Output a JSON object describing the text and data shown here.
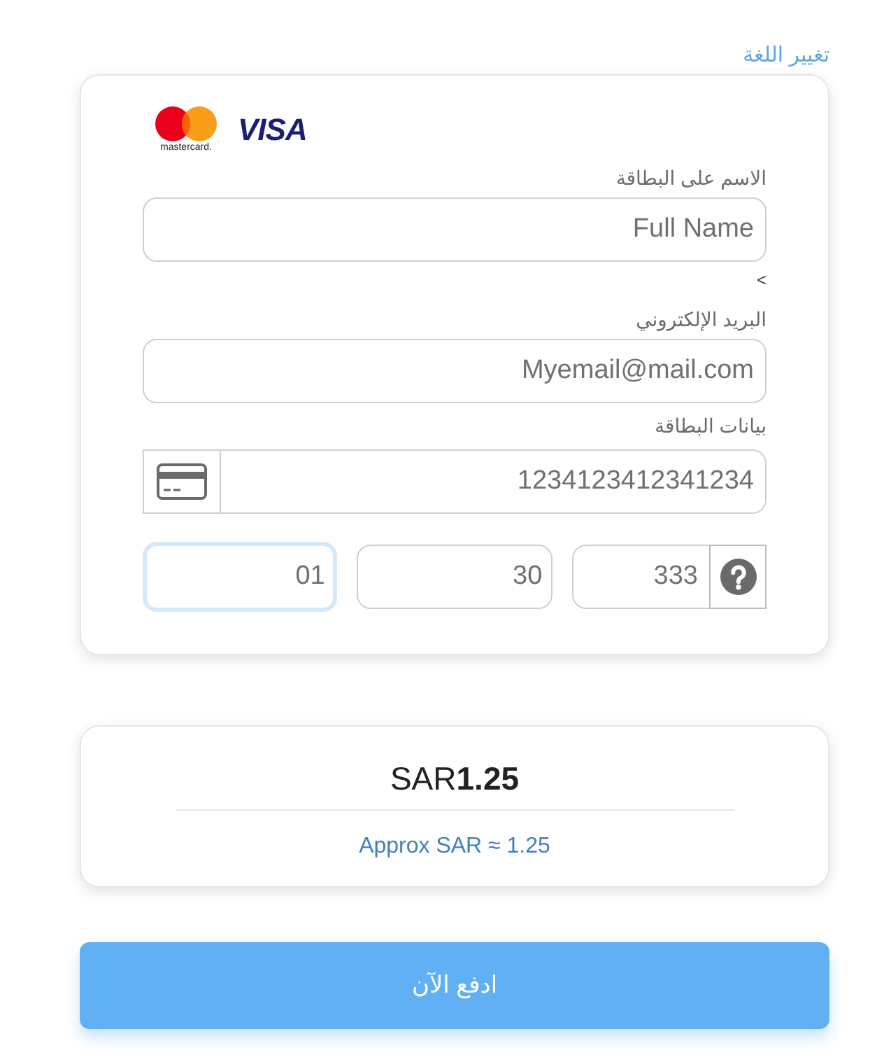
{
  "language_link": {
    "label": "تغيير اللغة"
  },
  "card_brands": [
    {
      "kind": "mastercard",
      "label": "mastercard."
    },
    {
      "kind": "visa",
      "label": "VISA"
    }
  ],
  "form": {
    "name_field": {
      "label": "الاسم على البطاقة",
      "placeholder": "Full Name"
    },
    "stray_text": "<",
    "email_field": {
      "label": "البريد الإلكتروني",
      "placeholder": "Myemail@mail.com"
    },
    "card_field": {
      "label": "بيانات البطاقة",
      "placeholder": "1234123412341234"
    },
    "detail_fields": [
      {
        "kind": "cvv",
        "placeholder": "333",
        "focused": false
      },
      {
        "kind": "year",
        "placeholder": "30",
        "focused": false
      },
      {
        "kind": "month",
        "placeholder": "01",
        "focused": true
      }
    ]
  },
  "amount": {
    "total": "SAR**1.25**",
    "approx": "Approx SAR ≈ 1.25"
  },
  "pay_button": {
    "label": "ادفع الآن"
  }
}
